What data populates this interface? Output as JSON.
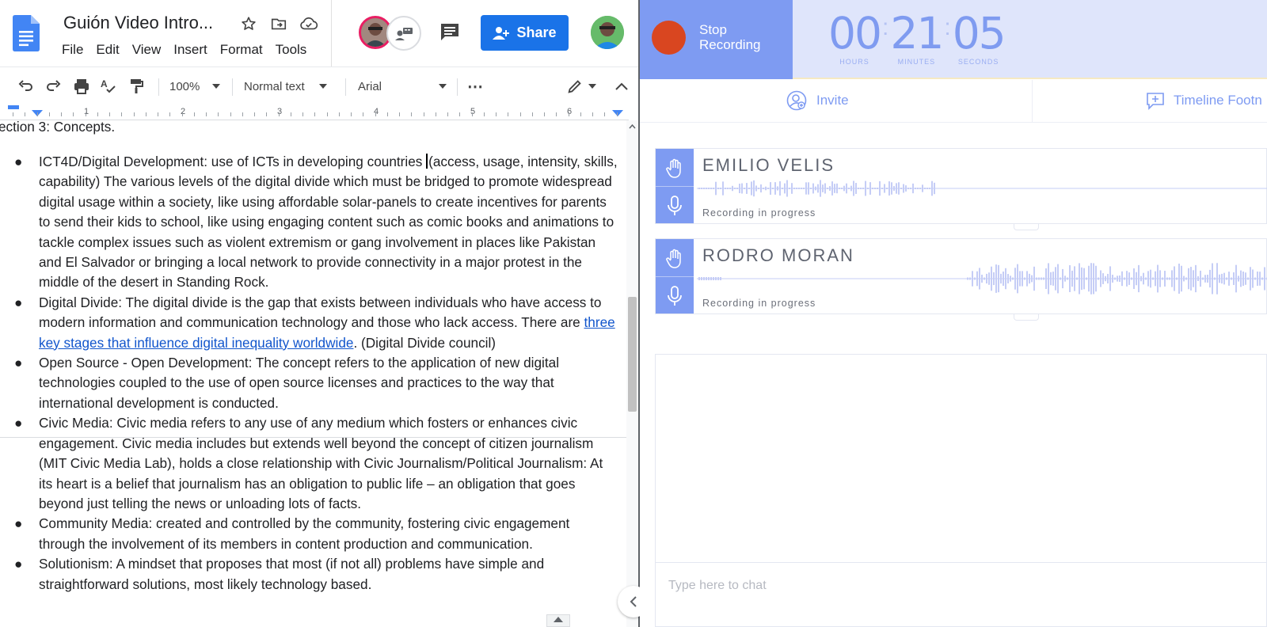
{
  "docs": {
    "title": "Guión Video Intro...",
    "menu": [
      "File",
      "Edit",
      "View",
      "Insert",
      "Format",
      "Tools"
    ],
    "share_label": "Share",
    "toolbar": {
      "zoom": "100%",
      "style": "Normal text",
      "font": "Arial",
      "more": "⋯"
    },
    "ruler_numbers": [
      "1",
      "2",
      "3",
      "4",
      "5",
      "6"
    ],
    "section_heading": "ection 3: Concepts.",
    "bullet_symbol": "●",
    "bullets": {
      "b1_pre": "ICT4D/Digital Development: use of ICTs in developing countries ",
      "b1_post": "(access, usage, intensity, skills, capability)  The various levels of the digital divide which must be bridged to promote widespread digital usage within a society, like using affordable solar-panels to create incentives for parents to send their kids to school, like using engaging content such as comic books and animations to tackle complex issues such as violent extremism or gang involvement in places like Pakistan and El Salvador or bringing a local network to provide connectivity in a major protest in the middle of the desert in Standing Rock.",
      "b2_pre": "Digital Divide: The digital divide is the gap that exists between individuals who have access to modern information and communication technology and those who lack access. There are ",
      "b2_link": "three key stages that influence digital inequality worldwide",
      "b2_post": ". (Digital Divide council)",
      "b3": "Open Source - Open Development: The concept refers to the application of new digital technologies coupled to the use of open source licenses and practices to the way that international development is conducted.",
      "b4": "Civic Media: Civic media refers to any use of any medium which fosters or enhances civic engagement. Civic media includes but extends well beyond the concept of citizen journalism (MIT Civic Media Lab), holds a close relationship with Civic Journalism/Political Journalism: At its heart is a belief that journalism has an obligation to public life – an obligation that goes beyond just telling the news or unloading lots of facts.",
      "b5": "Community Media: created and controlled by the community, fostering civic engagement through the involvement of its members in content production and communication.",
      "b6": "Solutionism: A mindset that proposes that most (if not all) problems have simple and straightforward solutions, most likely technology based."
    }
  },
  "recorder": {
    "stop_label_1": "Stop",
    "stop_label_2": "Recording",
    "timer": {
      "hours": "00",
      "minutes": "21",
      "seconds": "05",
      "hours_caption": "HOURS",
      "minutes_caption": "MINUTES",
      "seconds_caption": "SECONDS",
      "separator": ":"
    },
    "tabs": {
      "invite": "Invite",
      "timeline": "Timeline Footn"
    },
    "participants": [
      {
        "name": "EMILIO VELIS",
        "status": "Recording in progress"
      },
      {
        "name": "RODRO MORAN",
        "status": "Recording in progress"
      }
    ],
    "chat_placeholder": "Type here to chat"
  },
  "colors": {
    "docs_blue": "#1a73e8",
    "link": "#1155cc",
    "rec_accent": "#7e9bf2",
    "rec_dot": "#d94620",
    "rec_bg": "#dfe5fb",
    "wave": "#c5cdf6"
  },
  "icons": [
    "docs-logo-icon",
    "star-icon",
    "move-to-folder-icon",
    "cloud-saved-icon",
    "present-icon",
    "comment-icon",
    "person-add-icon",
    "undo-icon",
    "redo-icon",
    "print-icon",
    "spellcheck-icon",
    "paint-format-icon",
    "chevron-down-icon",
    "edit-pencil-icon",
    "chevron-up-icon",
    "hand-raise-icon",
    "microphone-icon",
    "invite-icon",
    "timeline-note-icon",
    "chevron-left-icon"
  ]
}
